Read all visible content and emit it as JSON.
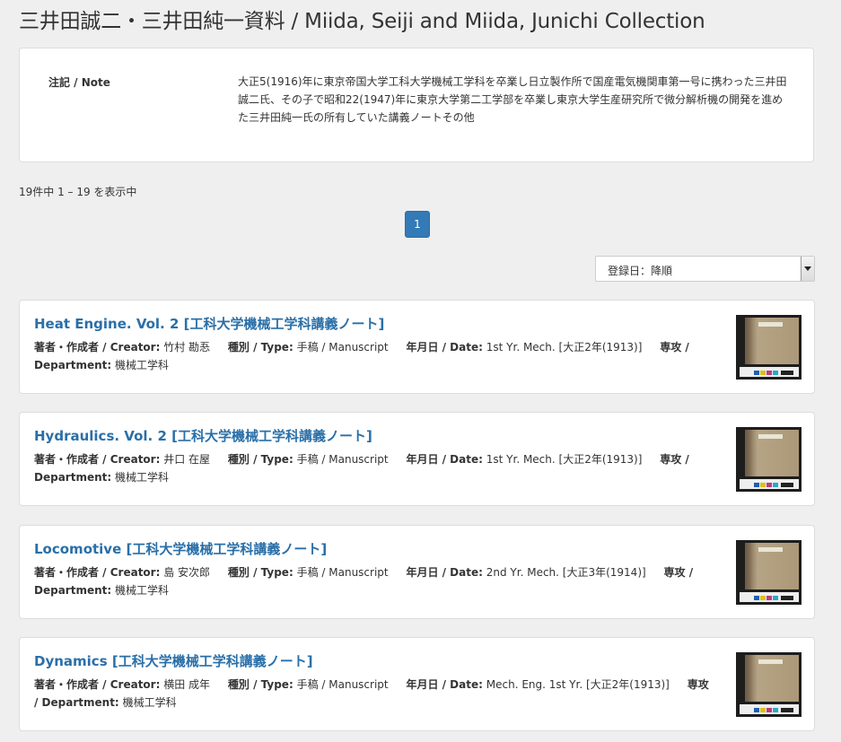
{
  "page": {
    "title": "三井田誠二・三井田純一資料 / Miida, Seiji and Miida, Junichi Collection"
  },
  "note": {
    "label": "注記 / Note",
    "text": "大正5(1916)年に東京帝国大学工科大学機械工学科を卒業し日立製作所で国産電気機関車第一号に携わった三井田誠二氏、その子で昭和22(1947)年に東京大学第二工学部を卒業し東京大学生産研究所で微分解析機の開発を進めた三井田純一氏の所有していた講義ノートその他"
  },
  "results": {
    "count_text": "19件中 1 – 19 を表示中",
    "page_number": "1",
    "sort_label": "登録日：降順"
  },
  "labels": {
    "creator": "著者・作成者 / Creator:",
    "type": "種別 / Type:",
    "date": "年月日 / Date:",
    "department": "専攻 / Department:"
  },
  "items": [
    {
      "title": "Heat Engine. Vol. 2 [工科大学機械工学科講義ノート]",
      "creator": "竹村 勘忢",
      "type": "手稿 / Manuscript",
      "date": "1st Yr. Mech. [大正2年(1913)]",
      "department": "機械工学科"
    },
    {
      "title": "Hydraulics. Vol. 2 [工科大学機械工学科講義ノート]",
      "creator": "井口 在屋",
      "type": "手稿 / Manuscript",
      "date": "1st Yr. Mech. [大正2年(1913)]",
      "department": "機械工学科"
    },
    {
      "title": "Locomotive [工科大学機械工学科講義ノート]",
      "creator": "島 安次郎",
      "type": "手稿 / Manuscript",
      "date": "2nd Yr. Mech. [大正3年(1914)]",
      "department": "機械工学科"
    },
    {
      "title": "Dynamics [工科大学機械工学科講義ノート]",
      "creator": "横田 成年",
      "type": "手稿 / Manuscript",
      "date": "Mech. Eng. 1st Yr. [大正2年(1913)]",
      "department": "機械工学科"
    }
  ],
  "colors": {
    "link": "#2a6fa8",
    "accent": "#337ab7",
    "background": "#efefef"
  }
}
